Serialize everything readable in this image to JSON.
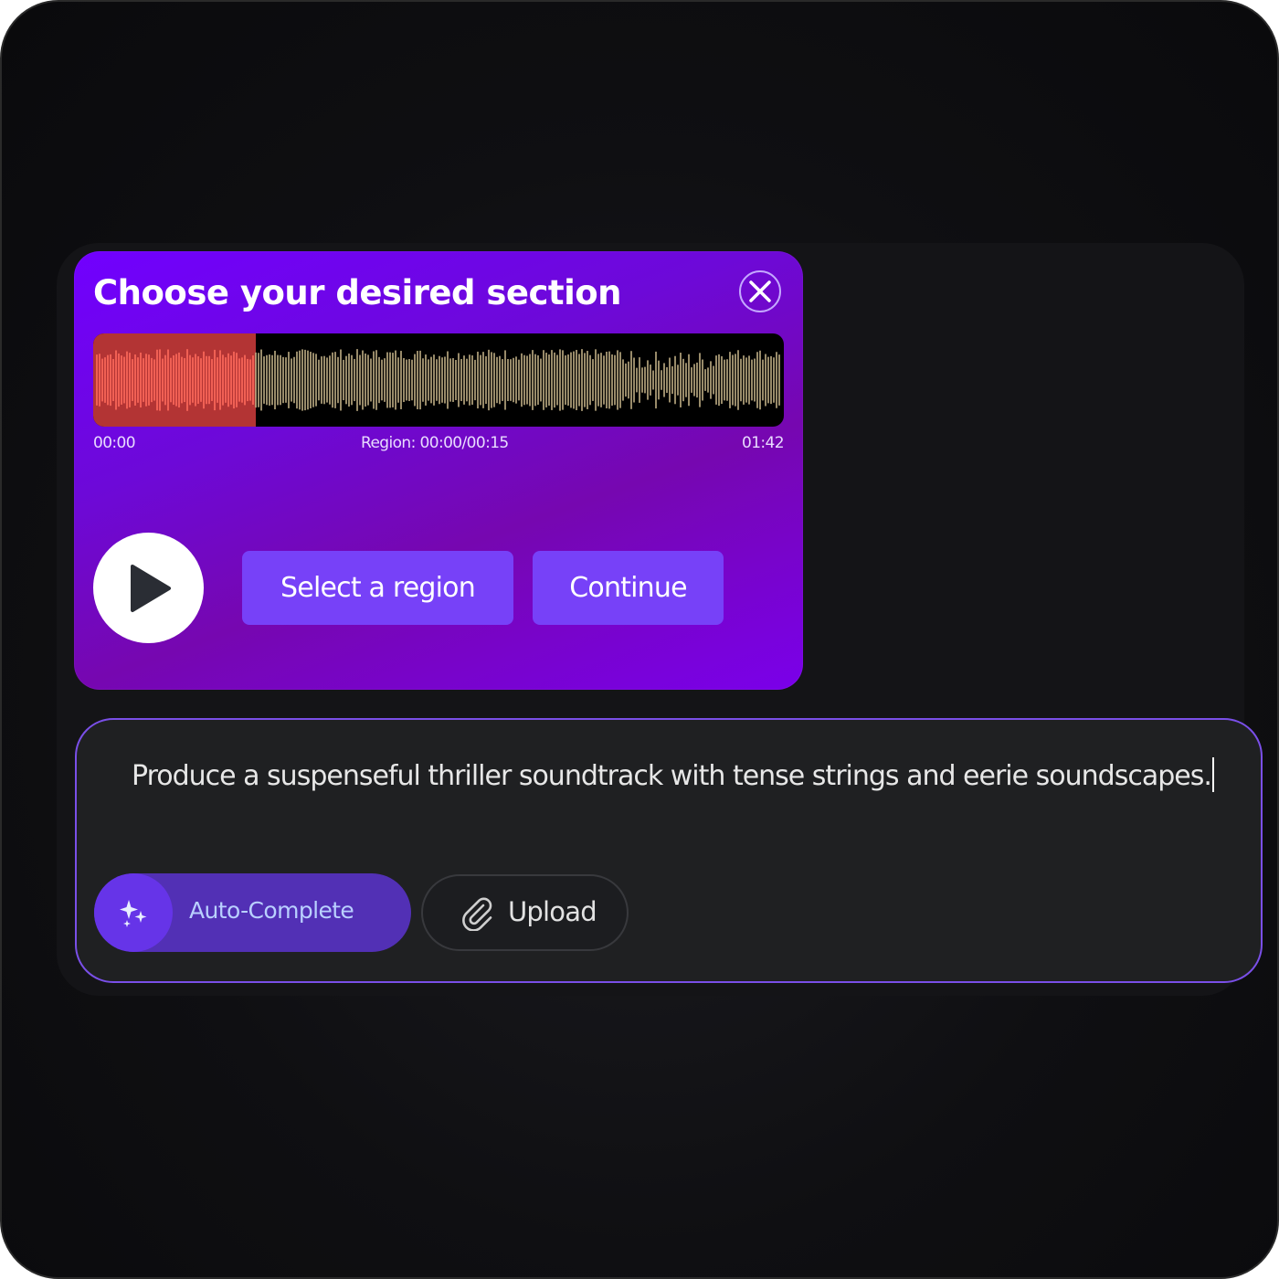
{
  "section_picker": {
    "title": "Choose your desired section",
    "close_icon": "close-icon",
    "waveform": {
      "selected_region_fraction": 0.147,
      "colors": {
        "selected_fill": "#b33434",
        "selected_wave": "#ff6b5c",
        "wave": "#bfae84",
        "background": "#000000"
      }
    },
    "start_time": "00:00",
    "region_label": "Region: 00:00/00:15",
    "end_time": "01:42",
    "play_icon": "play-icon",
    "select_region_label": "Select a region",
    "continue_label": "Continue"
  },
  "prompt": {
    "text": "Produce a suspenseful thriller soundtrack with tense strings and eerie soundscapes.",
    "autocomplete_label": "Auto-Complete",
    "autocomplete_icon": "sparkles-icon",
    "upload_label": "Upload",
    "upload_icon": "paperclip-icon"
  },
  "colors": {
    "accent": "#7741f8",
    "panel_gradient_start": "#7100ff",
    "panel_gradient_mid": "#7607b0",
    "prompt_border": "#7a4fe8"
  }
}
